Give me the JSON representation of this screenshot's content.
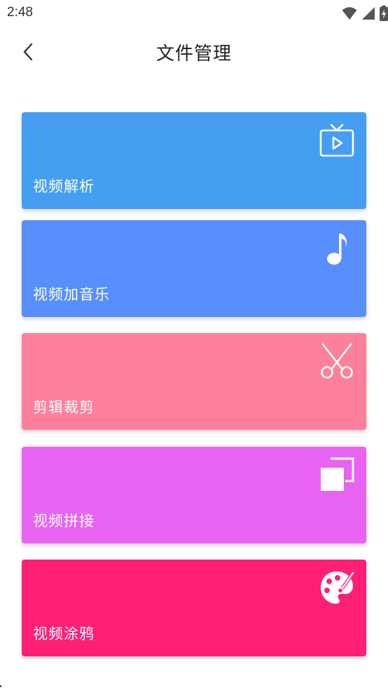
{
  "status_bar": {
    "time": "2:48",
    "icons": [
      "wifi-icon",
      "signal-icon",
      "battery-charging-icon"
    ]
  },
  "header": {
    "title": "文件管理",
    "back_icon": "chevron-left-icon"
  },
  "colors": {
    "card_1": "#459ef2",
    "card_2": "#588ffc",
    "card_3": "#ff809c",
    "card_4": "#e963f3",
    "card_5": "#ff1f75",
    "icon": "#ffffff"
  },
  "cards": [
    {
      "label": "视频解析",
      "icon": "tv-play-icon"
    },
    {
      "label": "视频加音乐",
      "icon": "music-note-icon"
    },
    {
      "label": "剪辑裁剪",
      "icon": "scissors-icon"
    },
    {
      "label": "视频拼接",
      "icon": "overlap-squares-icon"
    },
    {
      "label": "视频涂鸦",
      "icon": "palette-icon"
    }
  ]
}
